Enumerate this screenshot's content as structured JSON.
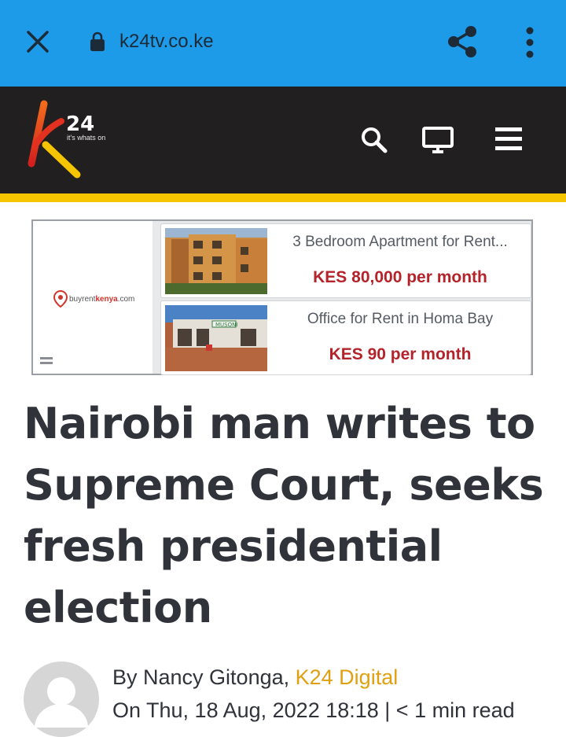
{
  "browser": {
    "url": "k24tv.co.ke",
    "icons": [
      "close-icon",
      "lock-icon",
      "share-icon",
      "more-vert-icon"
    ]
  },
  "header": {
    "logo_text": "24",
    "logo_tagline": "it's whats on",
    "icons": [
      "search-icon",
      "tv-icon",
      "menu-icon"
    ],
    "colors": {
      "background": "#221f20",
      "stripe": "#f7c500"
    }
  },
  "ad": {
    "brand_prefix": "buyrent",
    "brand_highlight": "kenya",
    "brand_suffix": ".com",
    "listings": [
      {
        "title": "3 Bedroom Apartment for Rent...",
        "price": "KES 80,000 per month"
      },
      {
        "title": "Office for Rent in Homa Bay",
        "price": "KES 90 per month",
        "sign_text": "MUSONI"
      }
    ]
  },
  "article": {
    "headline": "Nairobi man writes to Supreme Court, seeks fresh presidential election",
    "byline_prefix": "By ",
    "author": "Nancy Gitonga",
    "separator": ", ",
    "outlet": "K24 Digital",
    "date_prefix": "On ",
    "date": "Thu, 18 Aug, 2022 18:18",
    "read_time": " | < 1 min read"
  },
  "colors": {
    "browser_bar": "#1e9be8",
    "price": "#b4232a",
    "outlet": "#e0a010"
  }
}
